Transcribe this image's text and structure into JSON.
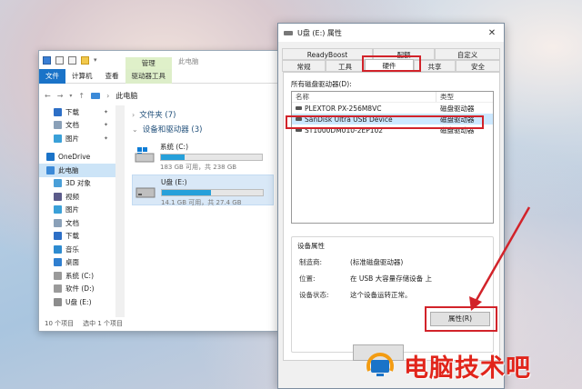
{
  "explorer": {
    "ribbon_tabs": [
      "文件",
      "计算机",
      "查看"
    ],
    "manage_tab": {
      "top": "管理",
      "bottom": "驱动器工具"
    },
    "page_title_tab": "此电脑",
    "address": "此电脑",
    "sidebar": [
      {
        "label": "下载",
        "pinned": true,
        "icon": "download-icon"
      },
      {
        "label": "文档",
        "pinned": true,
        "icon": "document-icon"
      },
      {
        "label": "图片",
        "pinned": true,
        "icon": "picture-icon"
      },
      {
        "label": "OneDrive",
        "pinned": false,
        "icon": "cloud-icon"
      },
      {
        "label": "此电脑",
        "pinned": false,
        "icon": "computer-icon"
      },
      {
        "label": "3D 对象",
        "pinned": false,
        "icon": "cube-icon"
      },
      {
        "label": "视频",
        "pinned": false,
        "icon": "video-icon"
      },
      {
        "label": "图片",
        "pinned": false,
        "icon": "picture-icon"
      },
      {
        "label": "文档",
        "pinned": false,
        "icon": "document-icon"
      },
      {
        "label": "下载",
        "pinned": false,
        "icon": "download-icon"
      },
      {
        "label": "音乐",
        "pinned": false,
        "icon": "music-icon"
      },
      {
        "label": "桌面",
        "pinned": false,
        "icon": "desktop-icon"
      },
      {
        "label": "系统 (C:)",
        "pinned": false,
        "icon": "drive-icon"
      },
      {
        "label": "软件 (D:)",
        "pinned": false,
        "icon": "drive-icon"
      },
      {
        "label": "U盘 (E:)",
        "pinned": false,
        "icon": "usb-icon"
      }
    ],
    "folders_group": "文件夹 (7)",
    "devices_group": "设备和驱动器 (3)",
    "drives": [
      {
        "name": "系统 (C:)",
        "free": "183 GB 可用，共 238 GB",
        "used_fraction": 0.23
      },
      {
        "name": "U盘 (E:)",
        "free": "14.1 GB 可用，共 27.4 GB",
        "used_fraction": 0.49
      }
    ],
    "status_items": "10 个项目",
    "status_selected": "选中 1 个项目"
  },
  "dialog": {
    "title": "U盘 (E:) 属性",
    "close": "✕",
    "tabs_row1": [
      "ReadyBoost",
      "配额",
      "自定义"
    ],
    "tabs_row2": [
      "常规",
      "工具",
      "硬件",
      "共享",
      "安全"
    ],
    "active_tab": "硬件",
    "all_drives_label": "所有磁盘驱动器(D):",
    "columns": [
      "名称",
      "类型"
    ],
    "rows": [
      {
        "name": "PLEXTOR PX-256M8VC",
        "type": "磁盘驱动器"
      },
      {
        "name": "SanDisk Ultra USB Device",
        "type": "磁盘驱动器"
      },
      {
        "name": "ST1000DM010-2EP102",
        "type": "磁盘驱动器"
      }
    ],
    "props_caption": "设备属性",
    "props": [
      {
        "k": "制造商:",
        "v": "(标准磁盘驱动器)"
      },
      {
        "k": "位置:",
        "v": "在 USB 大容量存储设备 上"
      },
      {
        "k": "设备状态:",
        "v": "这个设备运转正常。"
      }
    ],
    "props_button": "属性(R)"
  },
  "watermark": "电脑技术吧",
  "colors": {
    "highlight": "#d2232a",
    "accent": "#1a73c8",
    "progress": "#26a0da"
  }
}
